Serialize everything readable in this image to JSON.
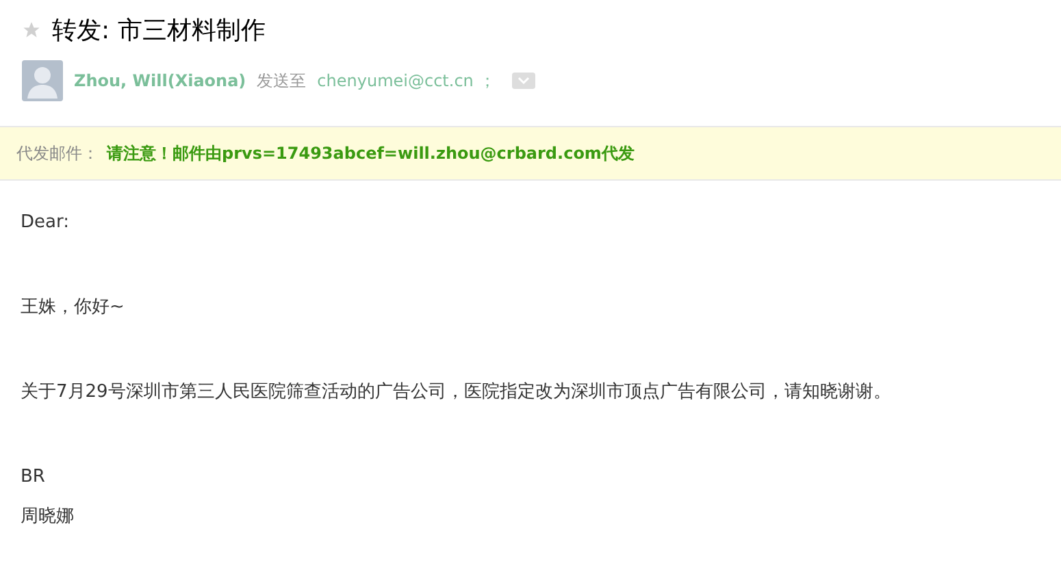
{
  "subject": {
    "title": "转发: 市三材料制作",
    "starred": false
  },
  "sender": {
    "name": "Zhou, Will(Xiaona)",
    "sent_to_label": "发送至",
    "recipient": "chenyumei@cct.cn",
    "separator": "；"
  },
  "notice": {
    "label": "代发邮件：",
    "message": "请注意！邮件由prvs=17493abcef=will.zhou@crbard.com代发"
  },
  "body": [
    [
      "Dear:"
    ],
    [
      "王姝，你好~"
    ],
    [
      "关于7月29号深圳市第三人民医院筛查活动的广告公司，医院指定改为深圳市顶点广告有限公司，请知晓谢谢。"
    ],
    [
      "BR",
      "周晓娜"
    ]
  ]
}
